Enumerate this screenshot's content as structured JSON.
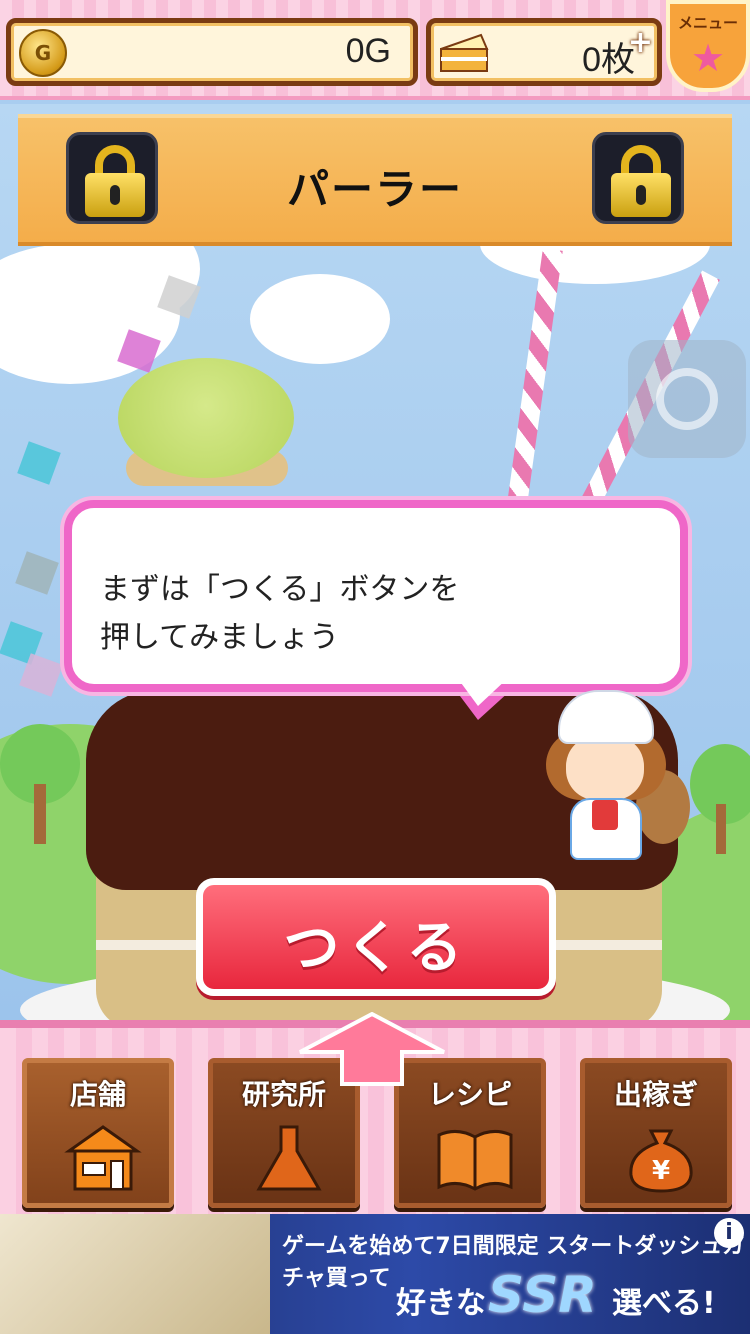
{
  "status": {
    "gold_value": "0G",
    "cake_value": "0枚",
    "plus_glyph": "+",
    "coin_glyph": "G",
    "menu_label": "メニュー",
    "menu_star": "★"
  },
  "banner": {
    "title": "パーラー"
  },
  "dialog": {
    "line1": "まずは「つくる」ボタンを",
    "line2": "押してみましょう"
  },
  "make_button": {
    "label": "つくる"
  },
  "nav": {
    "items": [
      {
        "label": "店舗",
        "icon": "shop-icon"
      },
      {
        "label": "研究所",
        "icon": "flask-icon"
      },
      {
        "label": "レシピ",
        "icon": "book-icon"
      },
      {
        "label": "出稼ぎ",
        "icon": "yen-bag-icon"
      }
    ]
  },
  "ad": {
    "line1": "ゲームを始めて7日間限定 スタートダッシュガチャ買って",
    "line2_a": "好きな",
    "line2_b": "SSR",
    "line2_c": "選べる!",
    "info_glyph": "i"
  },
  "colors": {
    "accent_pink": "#ef67c8",
    "button_red": "#e8273d",
    "wood": "#6a3315"
  }
}
